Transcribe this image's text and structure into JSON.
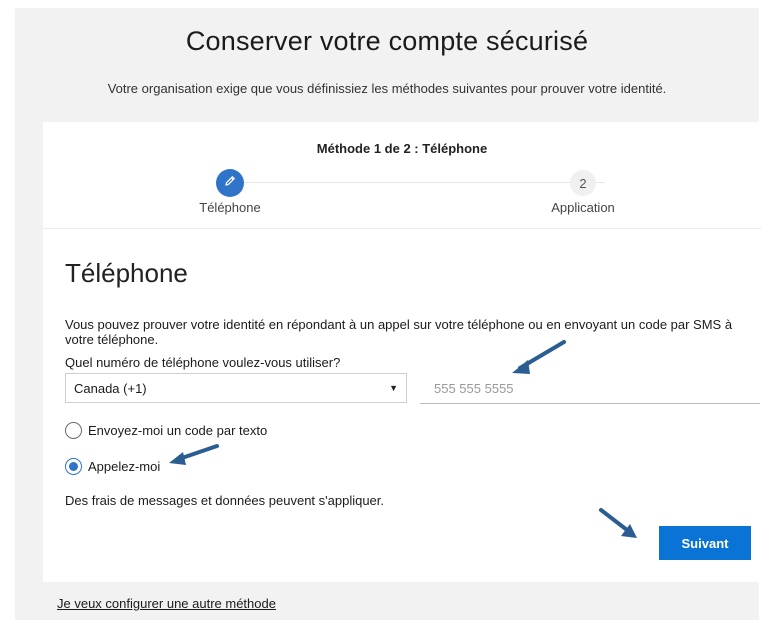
{
  "header": {
    "title": "Conserver votre compte sécurisé",
    "subtitle": "Votre organisation exige que vous définissiez les méthodes suivantes pour prouver votre identité."
  },
  "progress": {
    "caption": "Méthode 1 de 2 : Téléphone",
    "steps": [
      {
        "label": "Téléphone",
        "state": "current",
        "icon": "pencil-icon"
      },
      {
        "number": "2",
        "label": "Application",
        "state": "pending"
      }
    ]
  },
  "form": {
    "section_title": "Téléphone",
    "description": "Vous pouvez prouver votre identité en répondant à un appel sur votre téléphone ou en envoyant un code par SMS à votre téléphone.",
    "question": "Quel numéro de téléphone voulez-vous utiliser?",
    "country_select": {
      "selected": "Canada (+1)"
    },
    "phone_input": {
      "value": "555 555 5555"
    },
    "options": [
      {
        "label": "Envoyez-moi un code par texto",
        "checked": false
      },
      {
        "label": "Appelez-moi",
        "checked": true
      }
    ],
    "fees_notice": "Des frais de messages et données peuvent s'appliquer.",
    "next_label": "Suivant"
  },
  "footer": {
    "other_method_link": "Je veux configurer une autre méthode"
  },
  "colors": {
    "accent": "#2f74c8",
    "button": "#0a74d6",
    "annotation_arrow": "#2a5d91"
  }
}
